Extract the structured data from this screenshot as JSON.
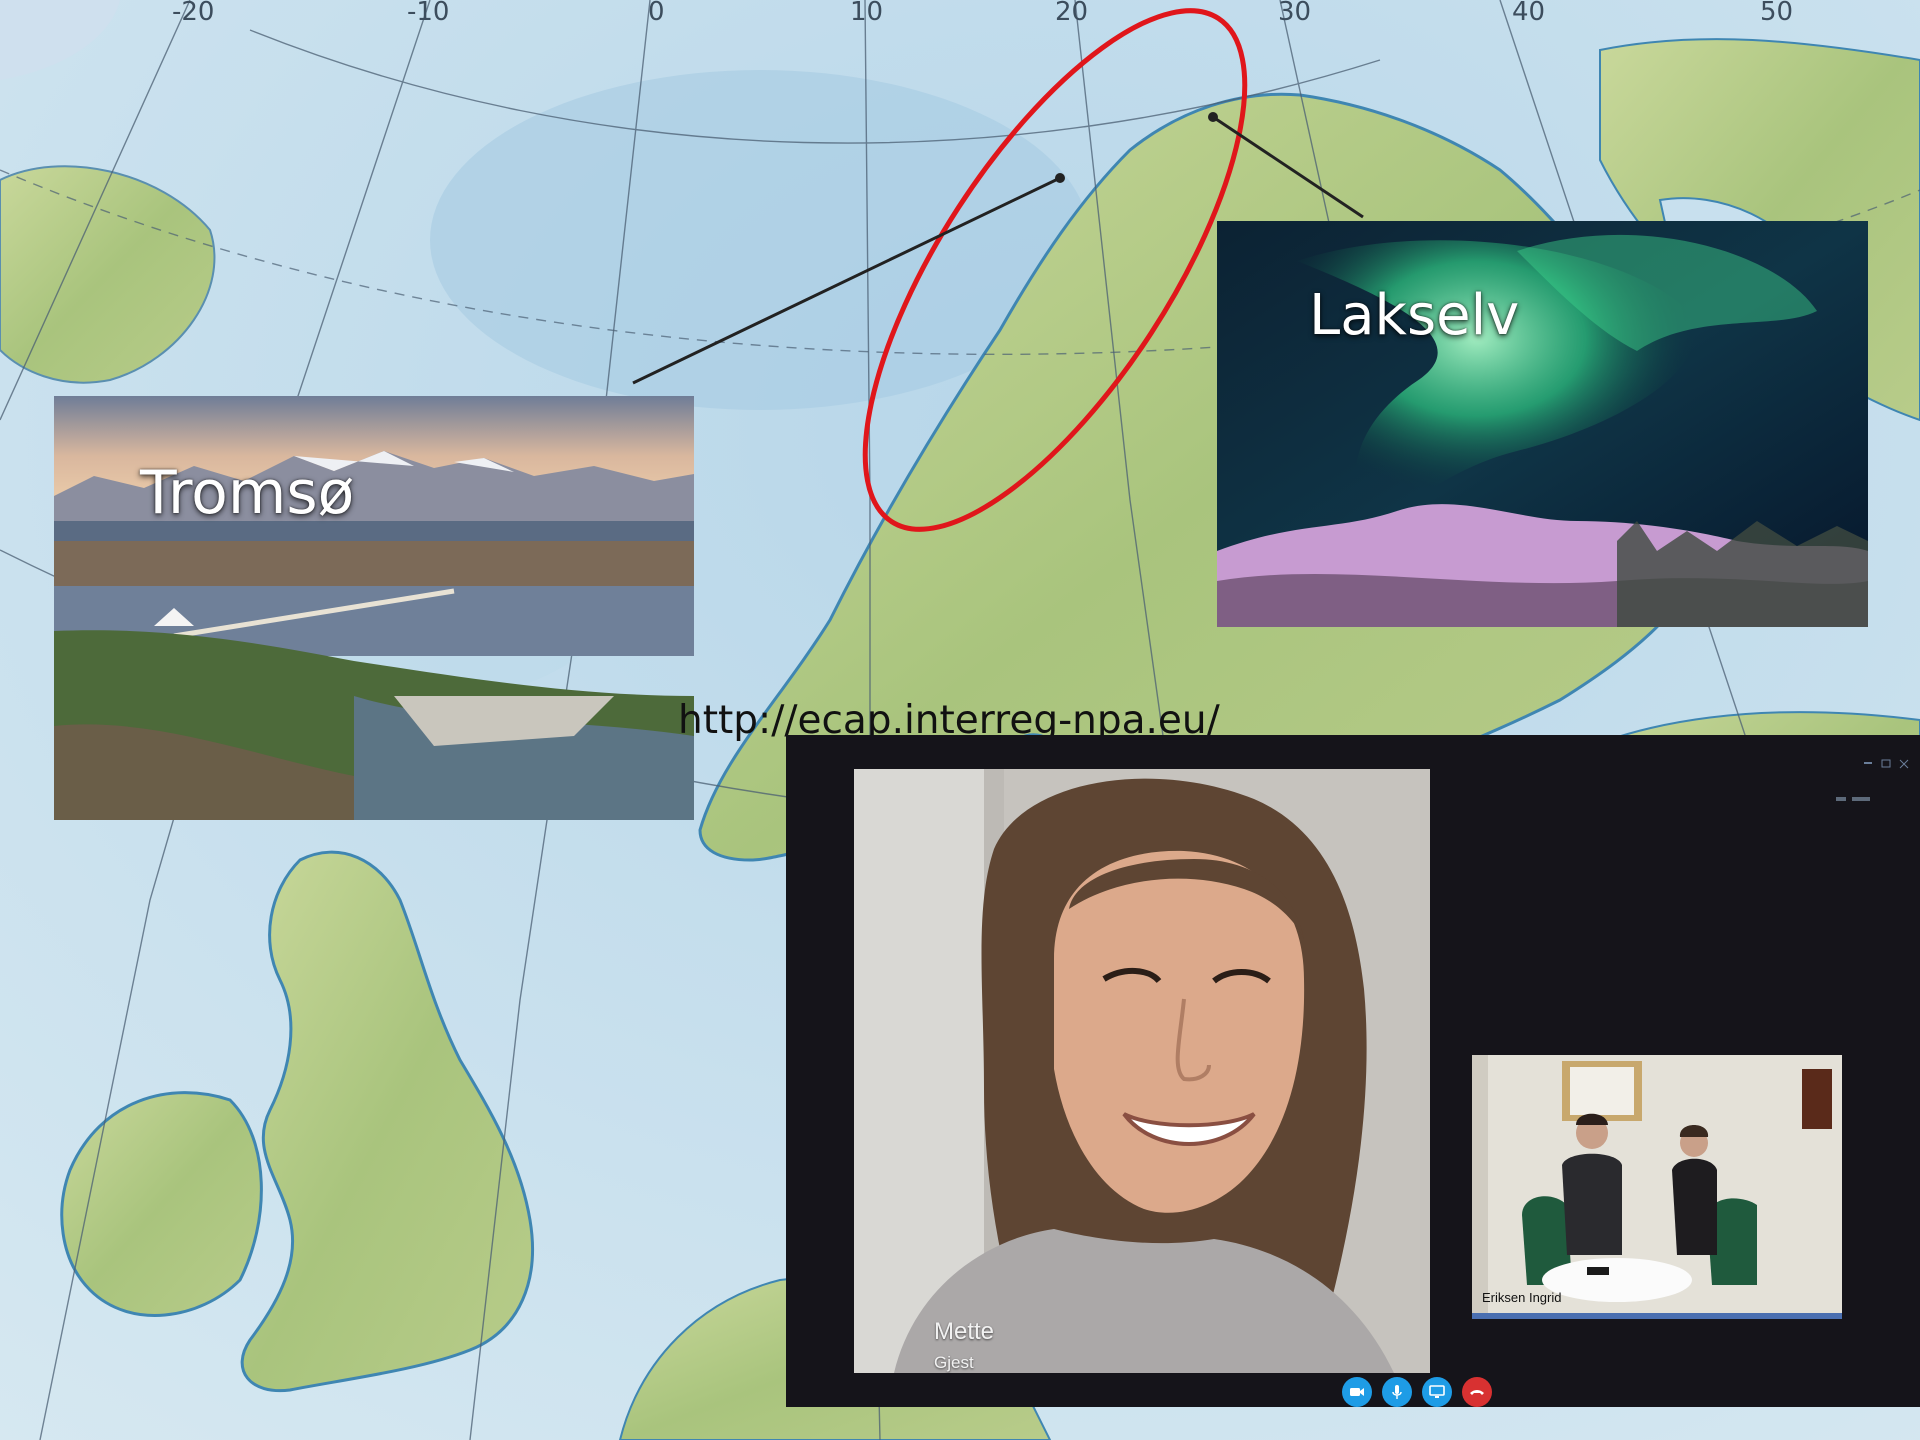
{
  "map": {
    "longitude_labels": [
      "-20",
      "-10",
      "0",
      "10",
      "20",
      "30",
      "40",
      "50"
    ],
    "highlight_color": "#e0161b"
  },
  "photos": {
    "tromso": {
      "label": "Tromsø"
    },
    "lakselv": {
      "label": "Lakselv"
    }
  },
  "url_caption": "http://ecap.interreg-npa.eu/",
  "video_call": {
    "main_participant": {
      "name": "Mette",
      "role": "Gjest"
    },
    "thumbnail_participant": {
      "name": "Eriksen Ingrid"
    },
    "controls": [
      {
        "icon": "camera-icon",
        "color": "#1e9ce6"
      },
      {
        "icon": "microphone-icon",
        "color": "#1e9ce6"
      },
      {
        "icon": "screen-share-icon",
        "color": "#1e9ce6"
      },
      {
        "icon": "hang-up-icon",
        "color": "#d83131"
      }
    ]
  }
}
